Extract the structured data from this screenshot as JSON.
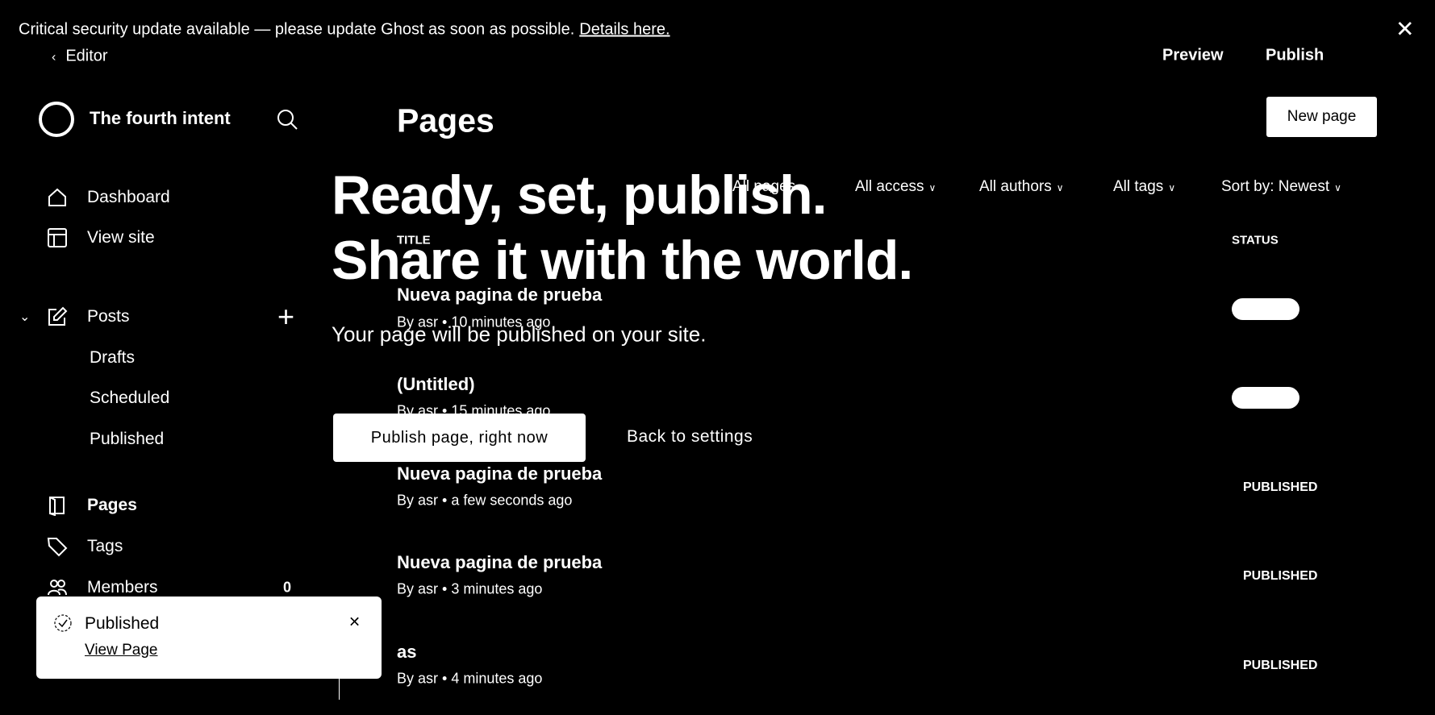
{
  "banner": {
    "text": "Critical security update available — please update Ghost as soon as possible.",
    "link": "Details here."
  },
  "editor_bar": {
    "back": "Editor",
    "preview": "Preview",
    "publish": "Publish"
  },
  "site": {
    "title": "The fourth intent"
  },
  "sidebar": {
    "items": [
      {
        "label": "Dashboard"
      },
      {
        "label": "View site"
      },
      {
        "label": "Posts"
      },
      {
        "label": "Drafts"
      },
      {
        "label": "Scheduled"
      },
      {
        "label": "Published"
      },
      {
        "label": "Pages"
      },
      {
        "label": "Tags"
      },
      {
        "label": "Members",
        "count": "0"
      }
    ]
  },
  "main": {
    "title": "Pages",
    "new_button": "New page",
    "filters": [
      "All pages",
      "All access",
      "All authors",
      "All tags",
      "Sort by: Newest"
    ],
    "columns": {
      "title": "TITLE",
      "status": "STATUS"
    },
    "rows": [
      {
        "title": "Nueva pagina de prueba",
        "meta": "By asr • 10 minutes ago",
        "status": ""
      },
      {
        "title": "(Untitled)",
        "meta": "By asr • 15 minutes ago",
        "status": ""
      },
      {
        "title": "Nueva pagina de prueba",
        "meta": "By asr • a few seconds ago",
        "status": "PUBLISHED"
      },
      {
        "title": "Nueva pagina de prueba",
        "meta": "By asr • 3 minutes ago",
        "status": "PUBLISHED"
      },
      {
        "title": "as",
        "meta": "By asr • 4 minutes ago",
        "status": "PUBLISHED"
      }
    ]
  },
  "publish_modal": {
    "line1": "Ready, set, publish.",
    "line2": "Share it with the world.",
    "desc": "Your page will be published on your site.",
    "confirm": "Publish page, right now",
    "back": "Back to settings"
  },
  "toast": {
    "title": "Published",
    "link": "View Page"
  }
}
